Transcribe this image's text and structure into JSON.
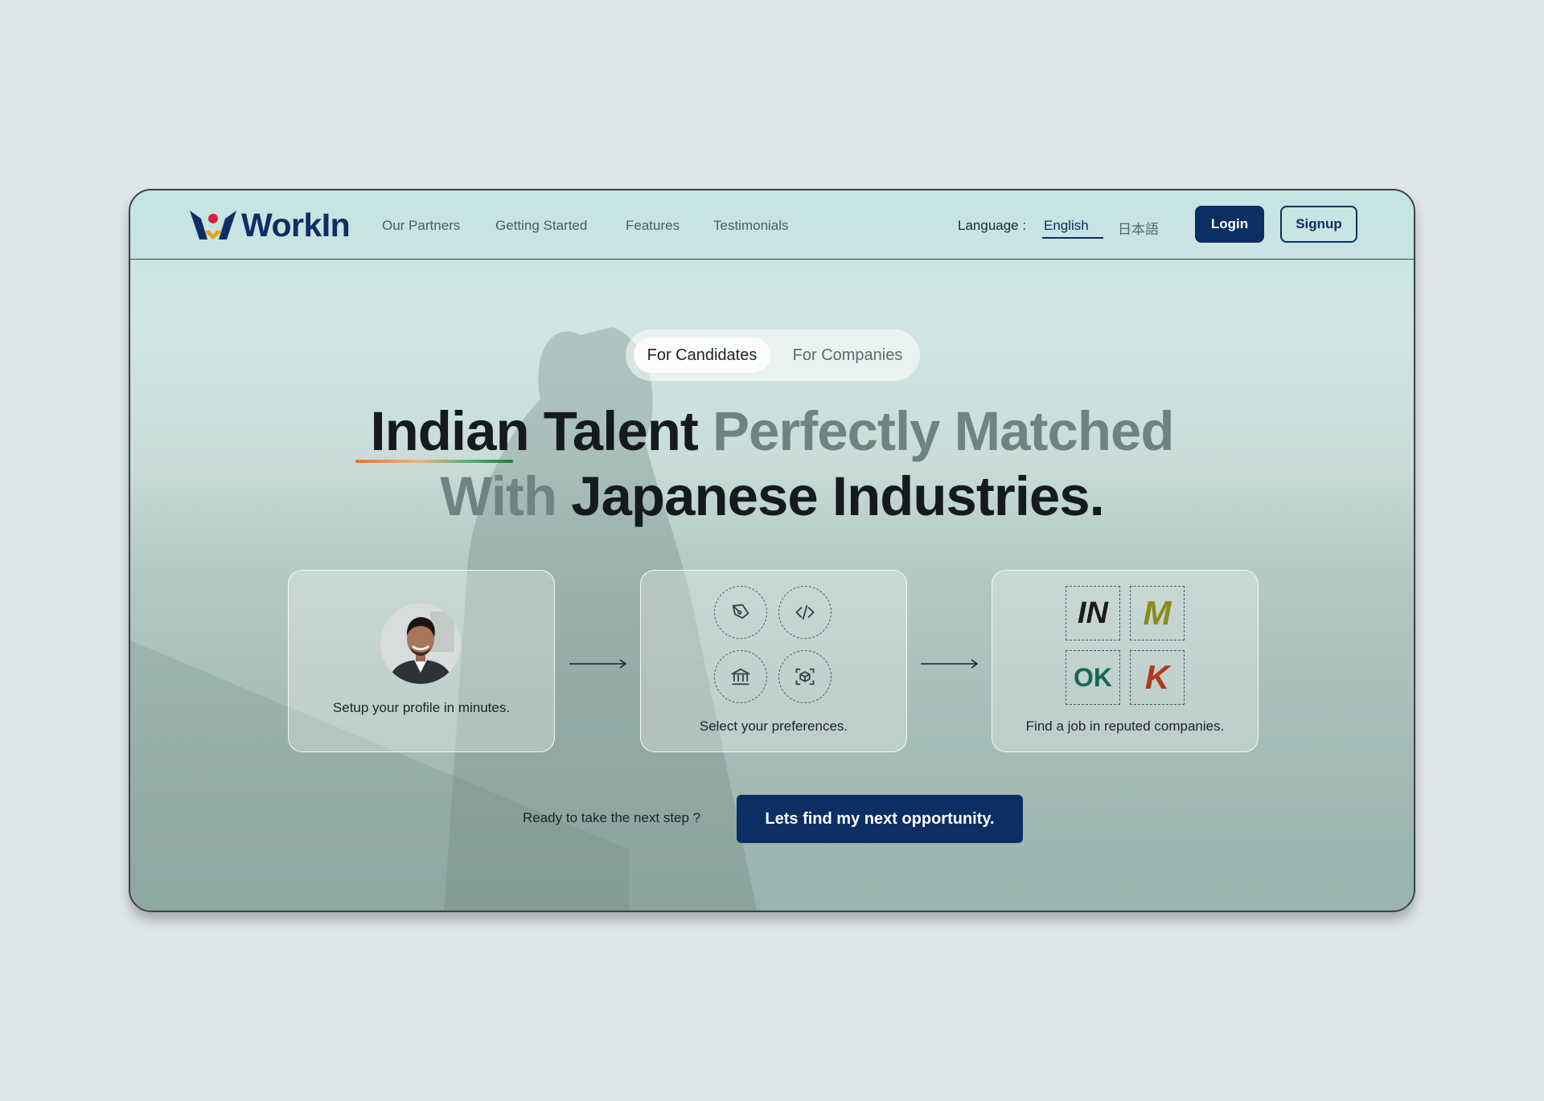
{
  "brand": {
    "name": "WorkIn"
  },
  "nav": {
    "links": [
      "Our Partners",
      "Getting Started",
      "Features",
      "Testimonials"
    ],
    "language_label": "Language :",
    "languages": [
      "English",
      "日本語"
    ],
    "selected_language": "English",
    "login_label": "Login",
    "signup_label": "Signup"
  },
  "audience_toggle": {
    "options": [
      "For Candidates",
      "For Companies"
    ],
    "selected": "For Candidates"
  },
  "hero": {
    "line1_dark": "Indian Talent",
    "line1_muted": "Perfectly Matched",
    "line2_muted": "With",
    "line2_dark": "Japanese Industries."
  },
  "steps": [
    {
      "label": "Setup your profile in minutes."
    },
    {
      "label": "Select your preferences.",
      "icons": [
        "pen-tool-icon",
        "code-icon",
        "bank-icon",
        "cube-scan-icon"
      ]
    },
    {
      "label": "Find a job in reputed companies.",
      "company_logos": [
        "IN",
        "M",
        "OK",
        "K"
      ]
    }
  ],
  "cta": {
    "prompt": "Ready to take the next step ?",
    "button_label": "Lets find my next opportunity."
  },
  "colors": {
    "primary": "#0d2e63",
    "page_background": "#dfe6e9",
    "headline_dark": "#141b1e",
    "headline_muted": "#6f8480",
    "logo_in": "#1d1a18",
    "logo_m": "#8a8a19",
    "logo_ok": "#14695a",
    "logo_k": "#b2381c"
  }
}
